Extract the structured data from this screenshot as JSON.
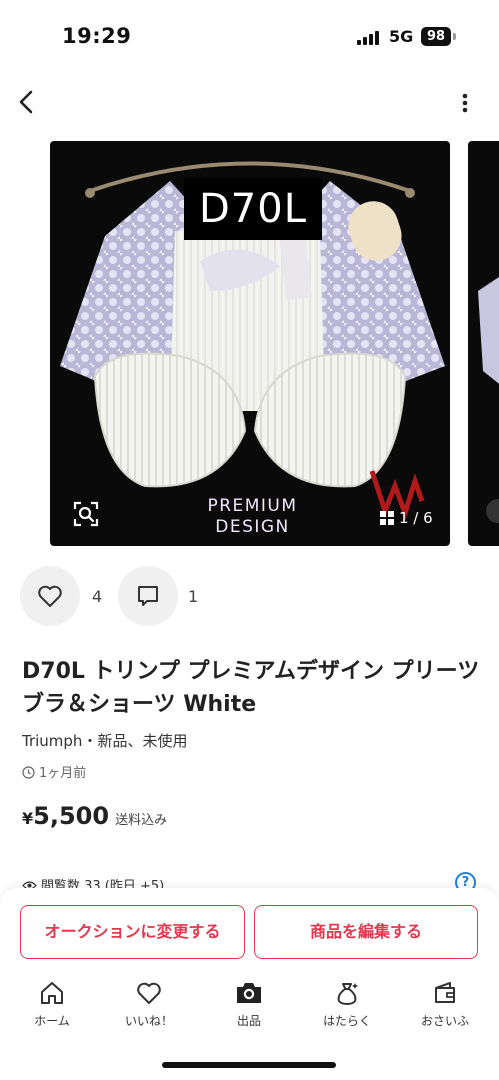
{
  "status_bar": {
    "time": "19:29",
    "network": "5G",
    "battery": "98"
  },
  "image_overlay": {
    "size_label": "D70L",
    "premium_line1": "PREMIUM",
    "premium_line2": "DESIGN",
    "counter": "1 / 6"
  },
  "engagement": {
    "likes": "4",
    "comments": "1"
  },
  "product": {
    "title": "D70L トリンプ プレミアムデザイン プリーツ ブラ＆ショーツ White",
    "brand_condition": "Triumph・新品、未使用",
    "posted": "1ヶ月前",
    "price_symbol": "¥",
    "price": "5,500",
    "shipping": "送料込み",
    "views": "閲覧数 33 (昨日 +5)"
  },
  "buttons": {
    "auction": "オークションに変更する",
    "edit": "商品を編集する"
  },
  "tabbar": {
    "home": "ホーム",
    "likes": "いいね！",
    "sell": "出品",
    "work": "はたらく",
    "wallet": "おさいふ"
  },
  "colors": {
    "accent": "#e5384f",
    "help": "#1f7fd6"
  }
}
